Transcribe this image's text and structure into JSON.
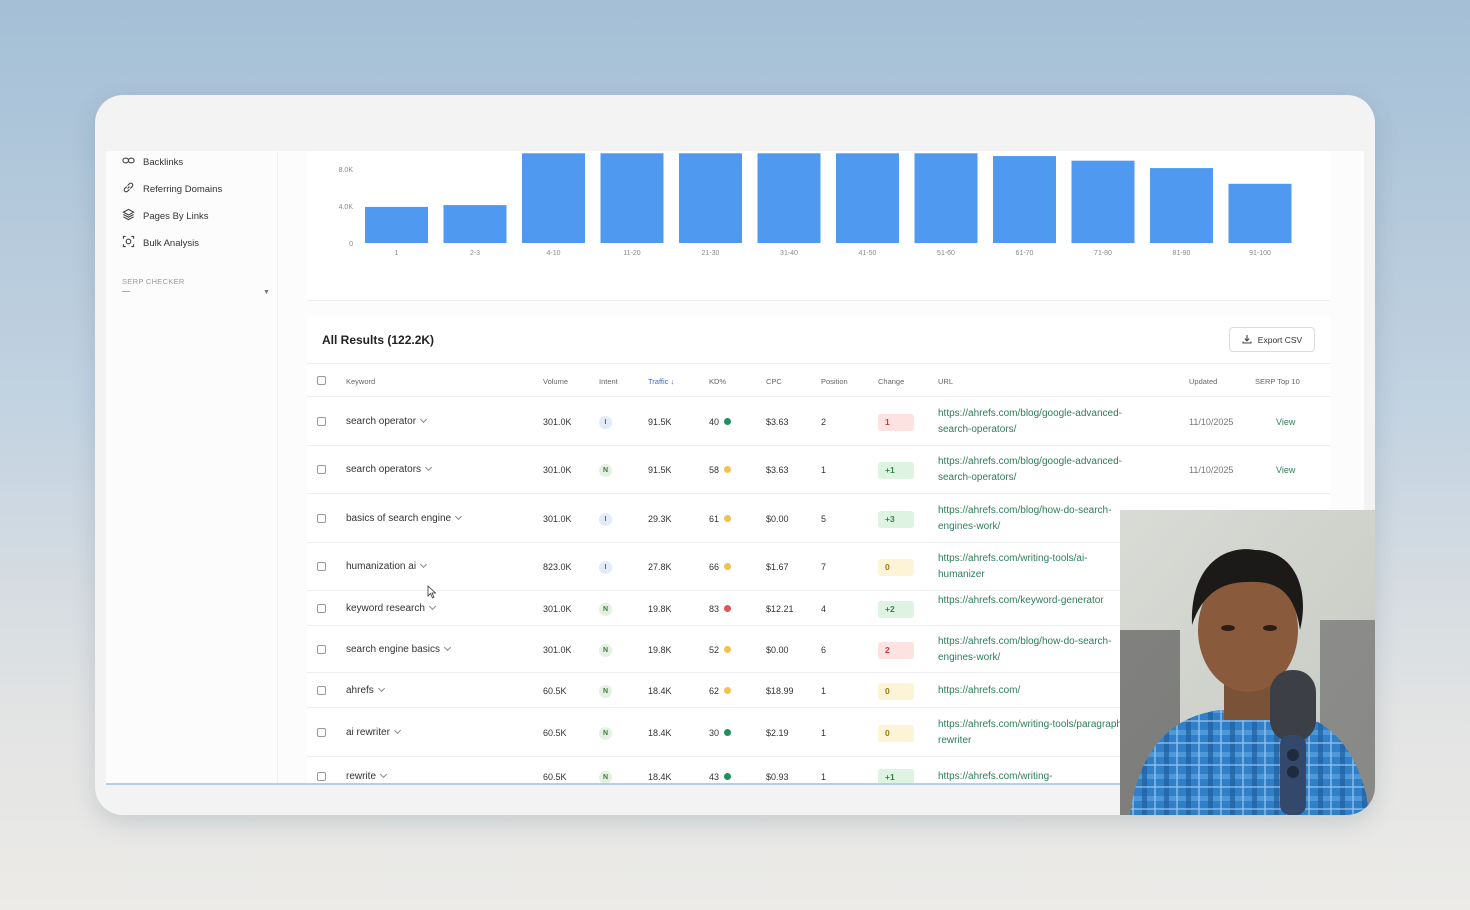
{
  "sidebar": {
    "items": [
      {
        "label": "Backlinks",
        "icon": "link-icon"
      },
      {
        "label": "Referring Domains",
        "icon": "chain-icon"
      },
      {
        "label": "Pages By Links",
        "icon": "layers-icon"
      },
      {
        "label": "Bulk Analysis",
        "icon": "scan-icon"
      }
    ],
    "section_heading": "SERP CHECKER"
  },
  "chart_data": {
    "type": "bar",
    "categories": [
      "1",
      "2-3",
      "4-10",
      "11-20",
      "21-30",
      "31-40",
      "41-50",
      "51-60",
      "61-70",
      "71-80",
      "81-90",
      "91-100"
    ],
    "values": [
      3.9,
      4.1,
      9.7,
      9.7,
      9.7,
      9.7,
      9.7,
      9.7,
      9.4,
      8.9,
      8.1,
      6.4
    ],
    "ytick_labels": [
      "0",
      "4.0K",
      "8.0K"
    ],
    "yticks": [
      0,
      4,
      8
    ],
    "ylim": [
      0,
      10
    ],
    "color": "#4f99f0",
    "grid": false
  },
  "results": {
    "title": "All Results (122.2K)",
    "export_label": "Export CSV",
    "columns": {
      "keyword": "Keyword",
      "volume": "Volume",
      "intent": "Intent",
      "traffic": "Traffic",
      "kd": "KD%",
      "cpc": "CPC",
      "position": "Position",
      "change": "Change",
      "url": "URL",
      "updated": "Updated",
      "serp": "SERP Top 10"
    },
    "rows": [
      {
        "keyword": "search operator",
        "volume": "301.0K",
        "intent": "I",
        "traffic": "91.5K",
        "kd": "40",
        "kd_color": "#1f8f5f",
        "cpc": "$3.63",
        "position": "2",
        "change": "1",
        "change_type": "down",
        "url": "https://ahrefs.com/blog/google-advanced-search-operators/",
        "updated": "11/10/2025",
        "serp": "View"
      },
      {
        "keyword": "search operators",
        "volume": "301.0K",
        "intent": "N",
        "traffic": "91.5K",
        "kd": "58",
        "kd_color": "#f2c14e",
        "cpc": "$3.63",
        "position": "1",
        "change": "+1",
        "change_type": "up",
        "url": "https://ahrefs.com/blog/google-advanced-search-operators/",
        "updated": "11/10/2025",
        "serp": "View"
      },
      {
        "keyword": "basics of search engine",
        "volume": "301.0K",
        "intent": "I",
        "traffic": "29.3K",
        "kd": "61",
        "kd_color": "#f2c14e",
        "cpc": "$0.00",
        "position": "5",
        "change": "+3",
        "change_type": "up",
        "url": "https://ahrefs.com/blog/how-do-search-engines-work/",
        "updated": "",
        "serp": ""
      },
      {
        "keyword": "humanization ai",
        "volume": "823.0K",
        "intent": "I",
        "traffic": "27.8K",
        "kd": "66",
        "kd_color": "#f2c14e",
        "cpc": "$1.67",
        "position": "7",
        "change": "0",
        "change_type": "neutral",
        "url": "https://ahrefs.com/writing-tools/ai-humanizer",
        "updated": "",
        "serp": ""
      },
      {
        "keyword": "keyword research",
        "volume": "301.0K",
        "intent": "N",
        "traffic": "19.8K",
        "kd": "83",
        "kd_color": "#e05555",
        "cpc": "$12.21",
        "position": "4",
        "change": "+2",
        "change_type": "up",
        "url": "https://ahrefs.com/keyword-generator",
        "updated": "",
        "serp": ""
      },
      {
        "keyword": "search engine basics",
        "volume": "301.0K",
        "intent": "N",
        "traffic": "19.8K",
        "kd": "52",
        "kd_color": "#f2c14e",
        "cpc": "$0.00",
        "position": "6",
        "change": "2",
        "change_type": "down",
        "url": "https://ahrefs.com/blog/how-do-search-engines-work/",
        "updated": "",
        "serp": ""
      },
      {
        "keyword": "ahrefs",
        "volume": "60.5K",
        "intent": "N",
        "traffic": "18.4K",
        "kd": "62",
        "kd_color": "#f2c14e",
        "cpc": "$18.99",
        "position": "1",
        "change": "0",
        "change_type": "neutral",
        "url": "https://ahrefs.com/",
        "updated": "",
        "serp": ""
      },
      {
        "keyword": "ai rewriter",
        "volume": "60.5K",
        "intent": "N",
        "traffic": "18.4K",
        "kd": "30",
        "kd_color": "#1f8f5f",
        "cpc": "$2.19",
        "position": "1",
        "change": "0",
        "change_type": "neutral",
        "url": "https://ahrefs.com/writing-tools/paragraph-rewriter",
        "updated": "",
        "serp": ""
      },
      {
        "keyword": "rewrite",
        "volume": "60.5K",
        "intent": "N",
        "traffic": "18.4K",
        "kd": "43",
        "kd_color": "#1f8f5f",
        "cpc": "$0.93",
        "position": "1",
        "change": "+1",
        "change_type": "up",
        "url": "https://ahrefs.com/writing-",
        "updated": "",
        "serp": ""
      }
    ]
  },
  "colors": {
    "accent": "#3b6bd6",
    "link": "#2e7d5a",
    "bar": "#4f99f0",
    "change_up_bg": "#dff3e3",
    "change_up_fg": "#2f8a47",
    "change_down_bg": "#fde2e2",
    "change_down_fg": "#c23b3b",
    "change_neutral_bg": "#fdf3d6",
    "change_neutral_fg": "#9a7a12"
  }
}
